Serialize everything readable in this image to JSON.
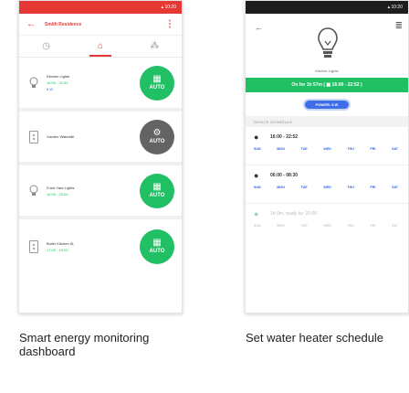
{
  "left_phone": {
    "status_text": "▴ 10:20",
    "appbar": {
      "back_icon": "←",
      "title": "Smith Residence",
      "menu_icon": "⋮"
    },
    "tabs": [
      {
        "icon": "clock-icon",
        "glyph": "◷"
      },
      {
        "icon": "home-icon",
        "glyph": "⌂"
      },
      {
        "icon": "network-icon",
        "glyph": "⁂"
      }
    ],
    "devices": [
      {
        "name": "Kitchen Lights",
        "sub": "16:00 - 22:52",
        "sub2": "8 W",
        "device_icon": "bulb-icon",
        "glyph": "💡",
        "button": "AUTO",
        "button_color": "#21c064",
        "button_icon": "calendar-icon",
        "button_glyph": "▦"
      },
      {
        "name": "Garden Waterfall",
        "sub": "",
        "sub2": "",
        "device_icon": "plug-icon",
        "glyph": "",
        "button": "AUTO",
        "button_color": "#636363",
        "button_icon": "gear-icon",
        "button_glyph": "⚙"
      },
      {
        "name": "Front Yard Lights",
        "sub": "16:00 - 23:00",
        "sub2": "",
        "device_icon": "bulb-icon",
        "glyph": "💡",
        "button": "AUTO",
        "button_color": "#21c064",
        "button_icon": "calendar-icon",
        "button_glyph": "▦"
      },
      {
        "name": "Boiler Kitchen 5L",
        "sub": "17:00 - 19:00",
        "sub2": "",
        "device_icon": "socket-icon",
        "glyph": "",
        "button": "AUTO",
        "button_color": "#21c064",
        "button_icon": "calendar-icon",
        "button_glyph": "▦"
      }
    ]
  },
  "right_phone": {
    "status_text": "▴ 10:20",
    "back_icon": "←",
    "menu_icon": "≣",
    "device_name": "Kitchen Lights",
    "banner": "On for 1h 57m ( ▦ 16:00 - 22:52 )",
    "power": "POWER: 8 W",
    "section_label": "DEVICE SCHEDULE",
    "schedules": [
      {
        "time": "16:00 - 22:52",
        "dim": false,
        "days": [
          "SUN",
          "MON",
          "TUE",
          "WED",
          "THU",
          "FRI",
          "SAT"
        ]
      },
      {
        "time": "06:00 - 08:30",
        "dim": false,
        "days": [
          "SUN",
          "MON",
          "TUE",
          "WED",
          "THU",
          "FRI",
          "SAT"
        ]
      },
      {
        "time": "1h 0m, ready by: 20:00",
        "dim": true,
        "days": [
          "SUN",
          "MON",
          "TUE",
          "WED",
          "THU",
          "FRI",
          "SAT"
        ]
      }
    ]
  },
  "captions": {
    "left": "Smart energy monitoring dashboard",
    "right": "Set water heater schedule"
  },
  "colors": {
    "accent_red": "#e53935",
    "accent_green": "#21c064",
    "accent_blue": "#3d6ee8",
    "button_grey": "#636363"
  }
}
